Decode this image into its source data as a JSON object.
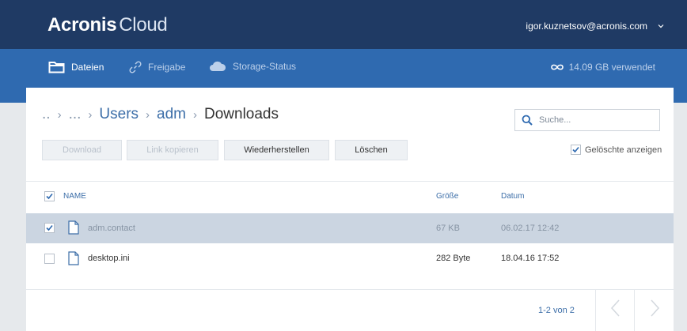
{
  "header": {
    "logo_brand": "Acronis",
    "logo_product": "Cloud",
    "user_email": "igor.kuznetsov@acronis.com"
  },
  "nav": {
    "files": "Dateien",
    "share": "Freigabe",
    "storage": "Storage-Status",
    "usage": "14.09 GB verwendet"
  },
  "breadcrumb": {
    "root": "..",
    "ellipsis": "...",
    "users": "Users",
    "adm": "adm",
    "current": "Downloads"
  },
  "search": {
    "placeholder": "Suche..."
  },
  "toolbar": {
    "download": "Download",
    "copy_link": "Link kopieren",
    "restore": "Wiederherstellen",
    "delete": "Löschen",
    "show_deleted": "Gelöschte anzeigen"
  },
  "table": {
    "headers": {
      "name": "NAME",
      "size": "Größe",
      "date": "Datum"
    },
    "rows": [
      {
        "name": "adm.contact",
        "size": "67 KB",
        "date": "06.02.17 12:42",
        "checked": true
      },
      {
        "name": "desktop.ini",
        "size": "282 Byte",
        "date": "18.04.16 17:52",
        "checked": false
      }
    ]
  },
  "pagination": {
    "label": "1-2 von 2"
  },
  "colors": {
    "header_dark": "#1f3a64",
    "nav_blue": "#2f6ab0",
    "link_blue": "#3c6ea8",
    "selected_row": "#cbd5e1"
  },
  "icons": [
    "folder-icon",
    "link-icon",
    "cloud-icon",
    "infinity-icon",
    "search-icon",
    "file-icon",
    "chevron-down-icon",
    "chevron-left-icon",
    "chevron-right-icon"
  ]
}
